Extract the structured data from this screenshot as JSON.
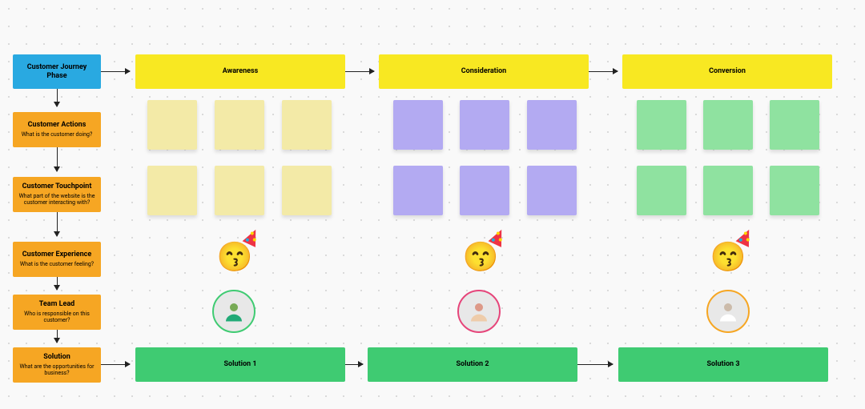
{
  "header": {
    "label": "Customer Journey Phase",
    "phases": [
      "Awareness",
      "Consideration",
      "Conversion"
    ]
  },
  "rows": {
    "actions": {
      "title": "Customer Actions",
      "sub": "What is the customer doing?"
    },
    "touchpoint": {
      "title": "Customer Touchpoint",
      "sub": "What part of the website is the customer interacting with?"
    },
    "experience": {
      "title": "Customer Experience",
      "sub": "What is the customer feeling?"
    },
    "teamlead": {
      "title": "Team Lead",
      "sub": "Who is responsible on this customer?"
    },
    "solution": {
      "title": "Solution",
      "sub": "What are the opportunities for business?"
    }
  },
  "solutions": [
    "Solution 1",
    "Solution 2",
    "Solution 3"
  ],
  "icons": {
    "experience_emoji": "party-face",
    "avatars": [
      "team-lead-1",
      "team-lead-2",
      "team-lead-3"
    ]
  },
  "colors": {
    "blue": "#29a9e1",
    "orange": "#f6a623",
    "yellow": "#f8e822",
    "green": "#3fcb72",
    "sticky_yellow": "#f3eaa7",
    "sticky_purple": "#b3aaf2",
    "sticky_green": "#8fe2a0"
  }
}
